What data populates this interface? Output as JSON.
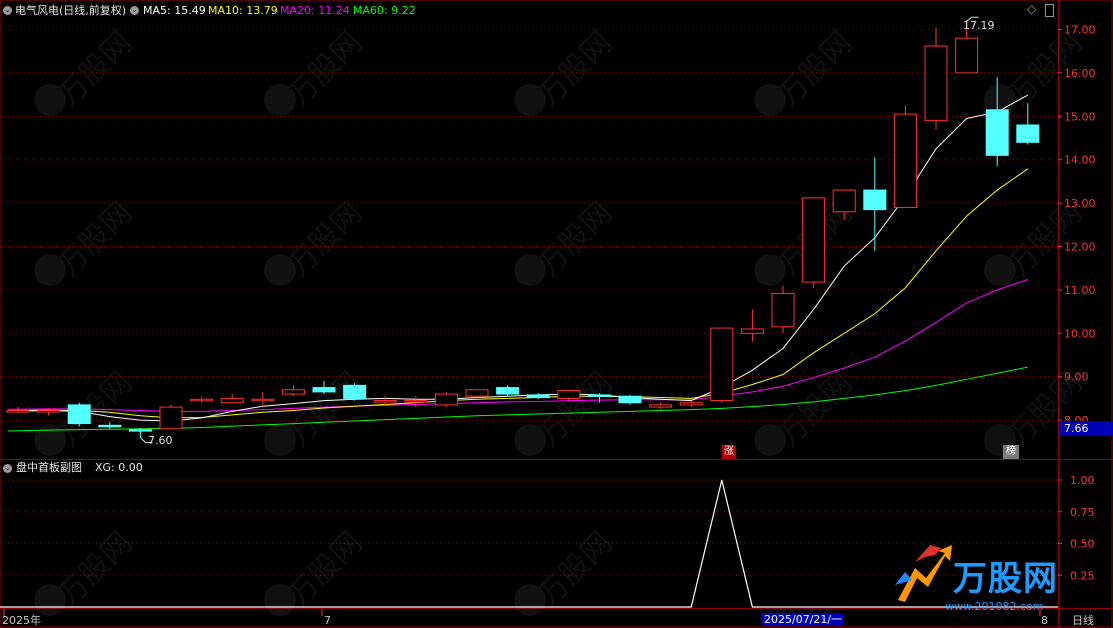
{
  "main_panel": {
    "stock_name": "电气风电(日线,前复权)",
    "indicators": [
      {
        "label": "MA5: 15.49",
        "color": "#ffffff"
      },
      {
        "label": "MA10: 13.79",
        "color": "#ffff00"
      },
      {
        "label": "MA20: 11.24",
        "color": "#ff00ff"
      },
      {
        "label": "MA60: 9.22",
        "color": "#00ff00"
      }
    ],
    "price_axis_labels": [
      "17.00",
      "16.00",
      "15.00",
      "14.00",
      "13.00",
      "12.00",
      "11.00",
      "10.00",
      "9.00",
      "8.00"
    ],
    "current_price_tag": "7.66",
    "high_marker": "17.19",
    "low_marker": "7.60",
    "limit_up_badge": "涨",
    "rank_badge": "榜"
  },
  "sub_panel": {
    "title": "盘中首板副图",
    "value_label": "XG: 0.00",
    "axis_labels": [
      "1.00",
      "0.75",
      "0.50",
      "0.25"
    ],
    "signal_series": [
      0,
      0,
      0,
      0,
      0,
      0,
      0,
      0,
      0,
      0,
      0,
      0,
      0,
      0,
      0,
      0,
      0,
      0,
      0,
      0,
      0,
      0,
      0,
      1,
      0,
      0,
      0,
      0,
      0,
      0,
      0,
      0,
      0,
      0
    ]
  },
  "footer": {
    "year_label": "2025年",
    "month_label_7": "7",
    "date_cursor": "2025/07/21/一",
    "month_label_8": "8",
    "period_label": "日线"
  },
  "watermark": {
    "brand": "万股网",
    "url": "www.201082.com"
  },
  "colors": {
    "up": "#ff3232",
    "down": "#54ffff",
    "grid": "#8b0000",
    "ma5": "#ffffff",
    "ma10": "#ffff00",
    "ma20": "#ff00ff",
    "ma60": "#00ff00"
  },
  "chart_data": {
    "type": "candlestick",
    "note_price_range": [
      7.6,
      17.19
    ],
    "candles": [
      {
        "o": 8.2,
        "c": 8.22,
        "h": 8.3,
        "l": 8.15
      },
      {
        "o": 8.2,
        "c": 8.22,
        "h": 8.28,
        "l": 8.1
      },
      {
        "o": 8.35,
        "c": 7.92,
        "h": 8.4,
        "l": 7.85
      },
      {
        "o": 7.88,
        "c": 7.85,
        "h": 7.95,
        "l": 7.8
      },
      {
        "o": 7.78,
        "c": 7.75,
        "h": 7.82,
        "l": 7.6
      },
      {
        "o": 7.8,
        "c": 8.3,
        "h": 8.35,
        "l": 7.78
      },
      {
        "o": 8.45,
        "c": 8.48,
        "h": 8.55,
        "l": 8.4
      },
      {
        "o": 8.4,
        "c": 8.5,
        "h": 8.6,
        "l": 8.38
      },
      {
        "o": 8.45,
        "c": 8.48,
        "h": 8.65,
        "l": 8.3
      },
      {
        "o": 8.6,
        "c": 8.7,
        "h": 8.8,
        "l": 8.55
      },
      {
        "o": 8.75,
        "c": 8.65,
        "h": 8.9,
        "l": 8.6
      },
      {
        "o": 8.8,
        "c": 8.5,
        "h": 8.85,
        "l": 8.45
      },
      {
        "o": 8.42,
        "c": 8.45,
        "h": 8.55,
        "l": 8.35
      },
      {
        "o": 8.42,
        "c": 8.45,
        "h": 8.55,
        "l": 8.3
      },
      {
        "o": 8.35,
        "c": 8.6,
        "h": 8.65,
        "l": 8.3
      },
      {
        "o": 8.55,
        "c": 8.7,
        "h": 8.72,
        "l": 8.5
      },
      {
        "o": 8.75,
        "c": 8.6,
        "h": 8.8,
        "l": 8.55
      },
      {
        "o": 8.58,
        "c": 8.52,
        "h": 8.62,
        "l": 8.48
      },
      {
        "o": 8.5,
        "c": 8.68,
        "h": 8.7,
        "l": 8.45
      },
      {
        "o": 8.58,
        "c": 8.55,
        "h": 8.62,
        "l": 8.4
      },
      {
        "o": 8.55,
        "c": 8.4,
        "h": 8.58,
        "l": 8.35
      },
      {
        "o": 8.3,
        "c": 8.35,
        "h": 8.4,
        "l": 8.25
      },
      {
        "o": 8.35,
        "c": 8.4,
        "h": 8.45,
        "l": 8.3
      },
      {
        "o": 8.45,
        "c": 10.12,
        "h": 10.12,
        "l": 8.4
      },
      {
        "o": 10.0,
        "c": 10.1,
        "h": 10.55,
        "l": 9.8
      },
      {
        "o": 10.15,
        "c": 10.92,
        "h": 11.1,
        "l": 10.0
      },
      {
        "o": 11.18,
        "c": 13.12,
        "h": 13.12,
        "l": 11.05
      },
      {
        "o": 12.8,
        "c": 13.3,
        "h": 13.3,
        "l": 12.6
      },
      {
        "o": 13.3,
        "c": 12.85,
        "h": 14.05,
        "l": 11.9
      },
      {
        "o": 12.9,
        "c": 15.05,
        "h": 15.25,
        "l": 12.9
      },
      {
        "o": 14.9,
        "c": 16.62,
        "h": 17.05,
        "l": 14.7
      },
      {
        "o": 16.0,
        "c": 16.8,
        "h": 17.19,
        "l": 16.0
      },
      {
        "o": 15.15,
        "c": 14.1,
        "h": 15.9,
        "l": 13.85
      },
      {
        "o": 14.8,
        "c": 14.4,
        "h": 15.3,
        "l": 14.35
      }
    ],
    "ma5": [
      8.2,
      8.22,
      8.2,
      8.08,
      8.0,
      7.98,
      8.05,
      8.2,
      8.32,
      8.38,
      8.45,
      8.48,
      8.5,
      8.48,
      8.48,
      8.52,
      8.55,
      8.58,
      8.6,
      8.58,
      8.52,
      8.48,
      8.45,
      8.75,
      9.15,
      9.65,
      10.55,
      11.55,
      12.2,
      13.15,
      14.25,
      14.95,
      15.1,
      15.49
    ],
    "ma10": [
      8.22,
      8.23,
      8.22,
      8.18,
      8.1,
      8.05,
      8.06,
      8.12,
      8.18,
      8.22,
      8.28,
      8.32,
      8.36,
      8.4,
      8.45,
      8.48,
      8.5,
      8.52,
      8.55,
      8.55,
      8.54,
      8.52,
      8.5,
      8.62,
      8.82,
      9.05,
      9.55,
      10.0,
      10.45,
      11.05,
      11.9,
      12.7,
      13.3,
      13.79
    ],
    "ma20": [
      8.25,
      8.26,
      8.26,
      8.24,
      8.22,
      8.2,
      8.2,
      8.22,
      8.24,
      8.27,
      8.3,
      8.32,
      8.34,
      8.36,
      8.38,
      8.4,
      8.42,
      8.43,
      8.45,
      8.46,
      8.47,
      8.47,
      8.47,
      8.55,
      8.65,
      8.78,
      8.98,
      9.2,
      9.45,
      9.82,
      10.25,
      10.7,
      11.0,
      11.24
    ],
    "ma60": [
      7.75,
      7.77,
      7.78,
      7.79,
      7.8,
      7.81,
      7.83,
      7.86,
      7.89,
      7.92,
      7.95,
      7.98,
      8.01,
      8.04,
      8.07,
      8.1,
      8.12,
      8.14,
      8.16,
      8.18,
      8.2,
      8.22,
      8.24,
      8.27,
      8.31,
      8.36,
      8.42,
      8.5,
      8.58,
      8.68,
      8.8,
      8.94,
      9.08,
      9.22
    ]
  }
}
